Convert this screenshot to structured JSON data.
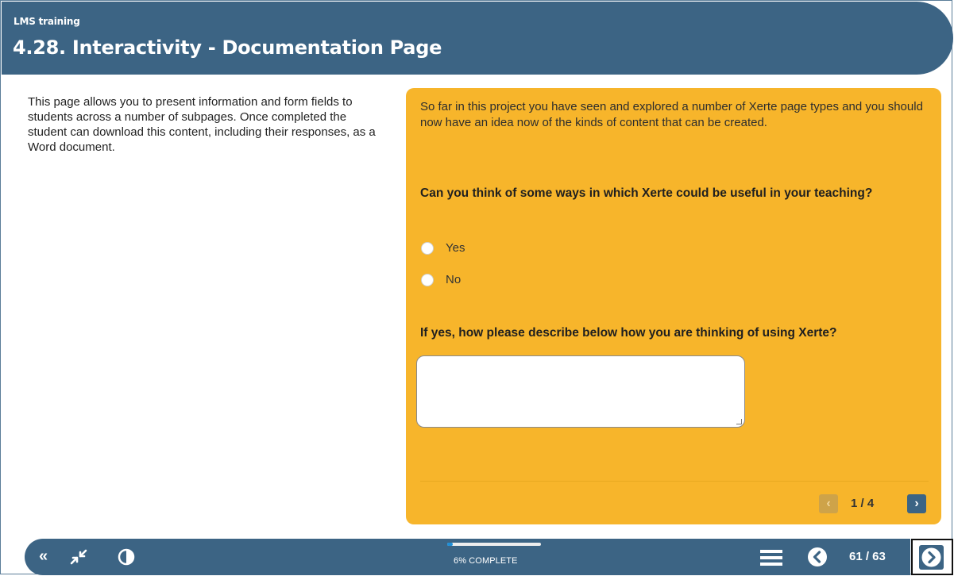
{
  "header": {
    "course_title": "LMS training",
    "page_title": "4.28. Interactivity - Documentation Page"
  },
  "intro": {
    "text": "This page allows you to present information and form fields to students across a number of subpages. Once completed the student can download this content, including their responses, as a Word document."
  },
  "panel": {
    "body_text": "So far in this project you have seen and explored a number of Xerte page types and you should now have an idea now of the kinds of content that can be created.",
    "question": "Can you think of some ways in which Xerte could be useful in your teaching?",
    "options": [
      {
        "label": "Yes"
      },
      {
        "label": "No"
      }
    ],
    "question2": "If yes, how please describe below how you are thinking of using Xerte?",
    "textarea_value": "",
    "subpage_counter": "1 / 4",
    "prev_icon": "chevron-left-icon",
    "next_icon": "chevron-right-icon"
  },
  "footer": {
    "progress_label": "6% COMPLETE",
    "progress_fraction": 0.06,
    "page_counter": "61 / 63"
  },
  "colors": {
    "header_bg": "#3c6484",
    "panel_bg": "#f7b52b",
    "progress_fill": "#1e8fd8"
  }
}
